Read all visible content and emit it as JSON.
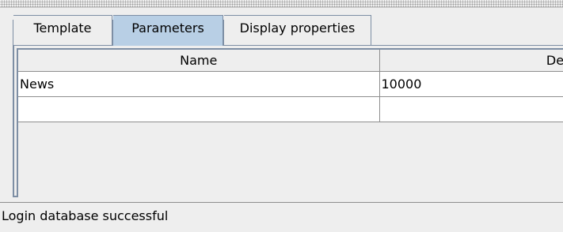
{
  "tabs": [
    {
      "label": "Template",
      "selected": false
    },
    {
      "label": "Parameters",
      "selected": true
    },
    {
      "label": "Display properties",
      "selected": false
    }
  ],
  "table": {
    "columns": [
      "Name",
      "Defa"
    ],
    "rows": [
      [
        "News",
        "10000"
      ],
      [
        "",
        ""
      ]
    ]
  },
  "status": {
    "message": "Login database successful"
  },
  "colors": {
    "selected_tab": "#b8cfe5",
    "border": "#7d8ea4",
    "background": "#eeeeee"
  }
}
